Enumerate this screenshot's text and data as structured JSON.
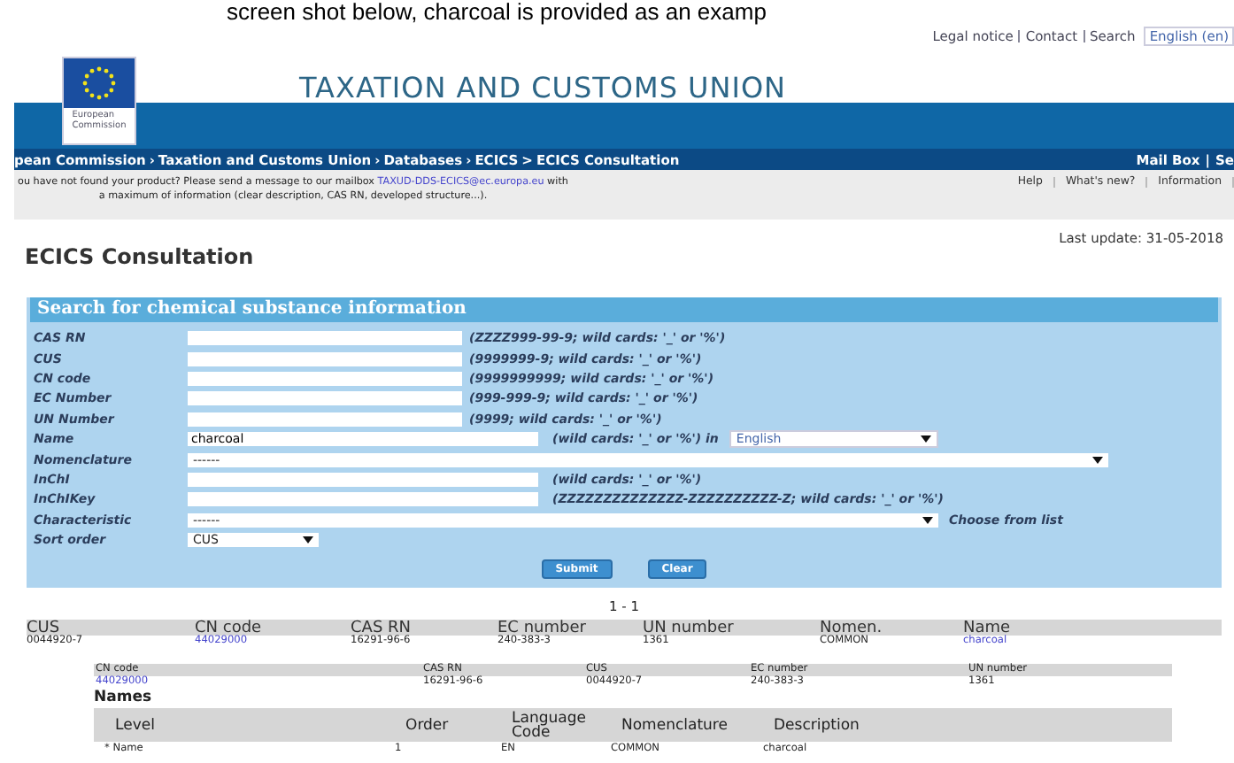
{
  "caption": "screen shot below, charcoal is provided as an examp",
  "top_links": [
    {
      "label": "Legal notice"
    },
    {
      "label": "Contact"
    },
    {
      "label": "Search"
    }
  ],
  "language": "English (en)",
  "logo_text": [
    "European",
    "Commission"
  ],
  "site_title": "TAXATION AND CUSTOMS UNION",
  "breadcrumb": [
    {
      "label": "pean Commission",
      "sep": "›"
    },
    {
      "label": "Taxation and Customs Union",
      "sep": "›"
    },
    {
      "label": "Databases",
      "sep": "›"
    },
    {
      "label": "ECICS",
      "sep": ">"
    },
    {
      "label": "ECICS Consultation"
    }
  ],
  "mail_links": [
    "Mail Box",
    "|",
    "Se"
  ],
  "notice": {
    "before": "ou have not found your product? Please send a message to our mailbox ",
    "email": "TAXUD-DDS-ECICS@ec.europa.eu",
    "after": " with a maximum of information (clear description, CAS RN, developed structure...)."
  },
  "help_links": [
    "Help",
    "What's new?",
    "Information"
  ],
  "page_title": "ECICS Consultation",
  "last_update": "Last update:  31-05-2018",
  "search": {
    "title": "Search for chemical substance information",
    "fields": [
      {
        "kind": "code",
        "label": "CAS RN",
        "hint": "(ZZZZ999-99-9; wild cards: '_' or '%')"
      },
      {
        "kind": "code",
        "label": "CUS",
        "hint": "(9999999-9; wild cards: '_' or '%')"
      },
      {
        "kind": "code",
        "label": "CN code",
        "hint": "(9999999999; wild cards: '_' or '%')"
      },
      {
        "kind": "code",
        "label": "EC Number",
        "hint": "(999-999-9; wild cards: '_' or '%')"
      },
      {
        "kind": "code",
        "label": "UN Number",
        "hint": "(9999; wild cards: '_' or '%')"
      },
      {
        "kind": "text",
        "label": "Name",
        "value": "charcoal",
        "hint": "(wild cards: '_' or '%') in",
        "select": "English"
      },
      {
        "kind": "wide-select",
        "label": "Nomenclature",
        "value": "------"
      },
      {
        "kind": "text",
        "label": "InChI",
        "hint": "(wild cards: '_' or '%')"
      },
      {
        "kind": "text",
        "label": "InChIKey",
        "hint": "(ZZZZZZZZZZZZZZ-ZZZZZZZZZZ-Z; wild cards: '_' or '%')"
      },
      {
        "kind": "select",
        "label": "Characteristic",
        "value": "------",
        "hint": "Choose from list"
      },
      {
        "kind": "small-select",
        "label": "Sort order",
        "value": "CUS"
      }
    ],
    "buttons": [
      "Submit",
      "Clear"
    ]
  },
  "pagination": "1 - 1",
  "results": {
    "columns": [
      "CUS",
      "CN code",
      "CAS RN",
      "EC number",
      "UN number",
      "Nomen.",
      "Name"
    ],
    "rows": [
      [
        {
          "text": "0044920-7",
          "link": false
        },
        {
          "text": "44029000",
          "link": true
        },
        {
          "text": "16291-96-6",
          "link": false
        },
        {
          "text": "240-383-3",
          "link": false
        },
        {
          "text": "1361",
          "link": false
        },
        {
          "text": "COMMON",
          "link": false
        },
        {
          "text": "charcoal",
          "link": true
        }
      ]
    ]
  },
  "detail": {
    "columns": [
      "CN code",
      "CAS RN",
      "CUS",
      "EC number",
      "UN number"
    ],
    "values": [
      {
        "text": "44029000",
        "link": true
      },
      {
        "text": "16291-96-6",
        "link": false
      },
      {
        "text": "0044920-7",
        "link": false
      },
      {
        "text": "240-383-3",
        "link": false
      },
      {
        "text": "1361",
        "link": false
      }
    ]
  },
  "names": {
    "title": "Names",
    "columns": [
      "Level",
      "Order",
      "Language Code",
      "Nomenclature",
      "Description"
    ],
    "rows": [
      [
        "* Name",
        "1",
        "EN",
        "COMMON",
        "charcoal"
      ]
    ]
  }
}
